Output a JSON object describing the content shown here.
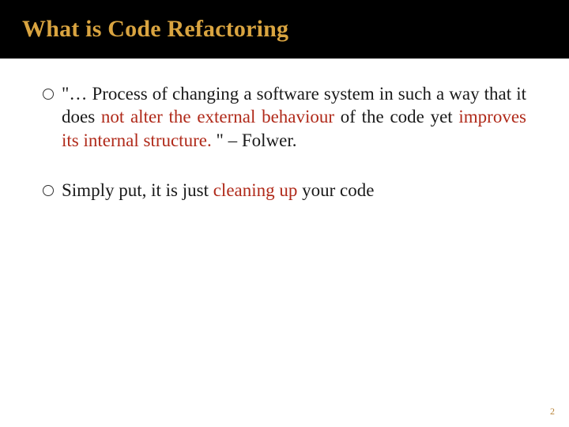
{
  "title": "What is Code Refactoring",
  "bullets": [
    {
      "parts": [
        {
          "t": "\"… Process of changing a software system in such a way that it does "
        },
        {
          "t": "not alter the external behaviour",
          "hl": true
        },
        {
          "t": " of the code yet "
        },
        {
          "t": "improves its internal structure.",
          "hl": true
        },
        {
          "t": " \" – Folwer."
        }
      ],
      "justify": true
    },
    {
      "parts": [
        {
          "t": "Simply put, it is just "
        },
        {
          "t": "cleaning up",
          "hl": true
        },
        {
          "t": " your code"
        }
      ],
      "justify": false
    }
  ],
  "page_number": "2"
}
